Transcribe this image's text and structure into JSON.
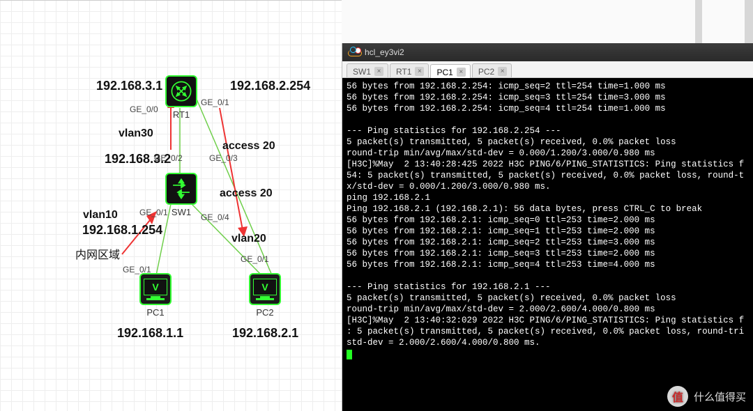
{
  "window": {
    "title": "hcl_ey3vi2"
  },
  "tabs": [
    {
      "label": "SW1",
      "active": false
    },
    {
      "label": "RT1",
      "active": false
    },
    {
      "label": "PC1",
      "active": true
    },
    {
      "label": "PC2",
      "active": false
    }
  ],
  "topology": {
    "nodes": {
      "rt1": {
        "caption": "RT1"
      },
      "sw1": {
        "caption": "SW1"
      },
      "pc1": {
        "caption": "PC1"
      },
      "pc2": {
        "caption": "PC2"
      }
    },
    "ip_labels": {
      "rt1_left": "192.168.3.1",
      "rt1_right": "192.168.2.254",
      "sw1_upper": "192.168.3.2",
      "sw1_left": "192.168.1.254",
      "pc1": "192.168.1.1",
      "pc2": "192.168.2.1"
    },
    "tags": {
      "vlan30": "vlan30",
      "access20_a": "access 20",
      "access20_b": "access 20",
      "vlan10": "vlan10",
      "vlan20": "vlan20",
      "inner_net": "内网区域"
    },
    "ports": {
      "rt1_ge00": "GE_0/0",
      "rt1_ge01": "GE_0/1",
      "sw1_ge02": "GE_0/2",
      "sw1_ge03": "GE_0/3",
      "sw1_ge01": "GE_0/1",
      "sw1_ge04": "GE_0/4",
      "pc1_ge01": "GE_0/1",
      "pc2_ge01": "GE_0/1"
    }
  },
  "terminal_lines": [
    "56 bytes from 192.168.2.254: icmp_seq=2 ttl=254 time=1.000 ms",
    "56 bytes from 192.168.2.254: icmp_seq=3 ttl=254 time=3.000 ms",
    "56 bytes from 192.168.2.254: icmp_seq=4 ttl=254 time=1.000 ms",
    "",
    "--- Ping statistics for 192.168.2.254 ---",
    "5 packet(s) transmitted, 5 packet(s) received, 0.0% packet loss",
    "round-trip min/avg/max/std-dev = 0.000/1.200/3.000/0.980 ms",
    "[H3C]%May  2 13:40:28:425 2022 H3C PING/6/PING_STATISTICS: Ping statistics f",
    "54: 5 packet(s) transmitted, 5 packet(s) received, 0.0% packet loss, round-t",
    "x/std-dev = 0.000/1.200/3.000/0.980 ms.",
    "ping 192.168.2.1",
    "Ping 192.168.2.1 (192.168.2.1): 56 data bytes, press CTRL_C to break",
    "56 bytes from 192.168.2.1: icmp_seq=0 ttl=253 time=2.000 ms",
    "56 bytes from 192.168.2.1: icmp_seq=1 ttl=253 time=2.000 ms",
    "56 bytes from 192.168.2.1: icmp_seq=2 ttl=253 time=3.000 ms",
    "56 bytes from 192.168.2.1: icmp_seq=3 ttl=253 time=2.000 ms",
    "56 bytes from 192.168.2.1: icmp_seq=4 ttl=253 time=4.000 ms",
    "",
    "--- Ping statistics for 192.168.2.1 ---",
    "5 packet(s) transmitted, 5 packet(s) received, 0.0% packet loss",
    "round-trip min/avg/max/std-dev = 2.000/2.600/4.000/0.800 ms",
    "[H3C]%May  2 13:40:32:029 2022 H3C PING/6/PING_STATISTICS: Ping statistics f",
    ": 5 packet(s) transmitted, 5 packet(s) received, 0.0% packet loss, round-tri",
    "std-dev = 2.000/2.600/4.000/0.800 ms."
  ],
  "watermark": {
    "text": "什么值得买",
    "badge": "值"
  }
}
